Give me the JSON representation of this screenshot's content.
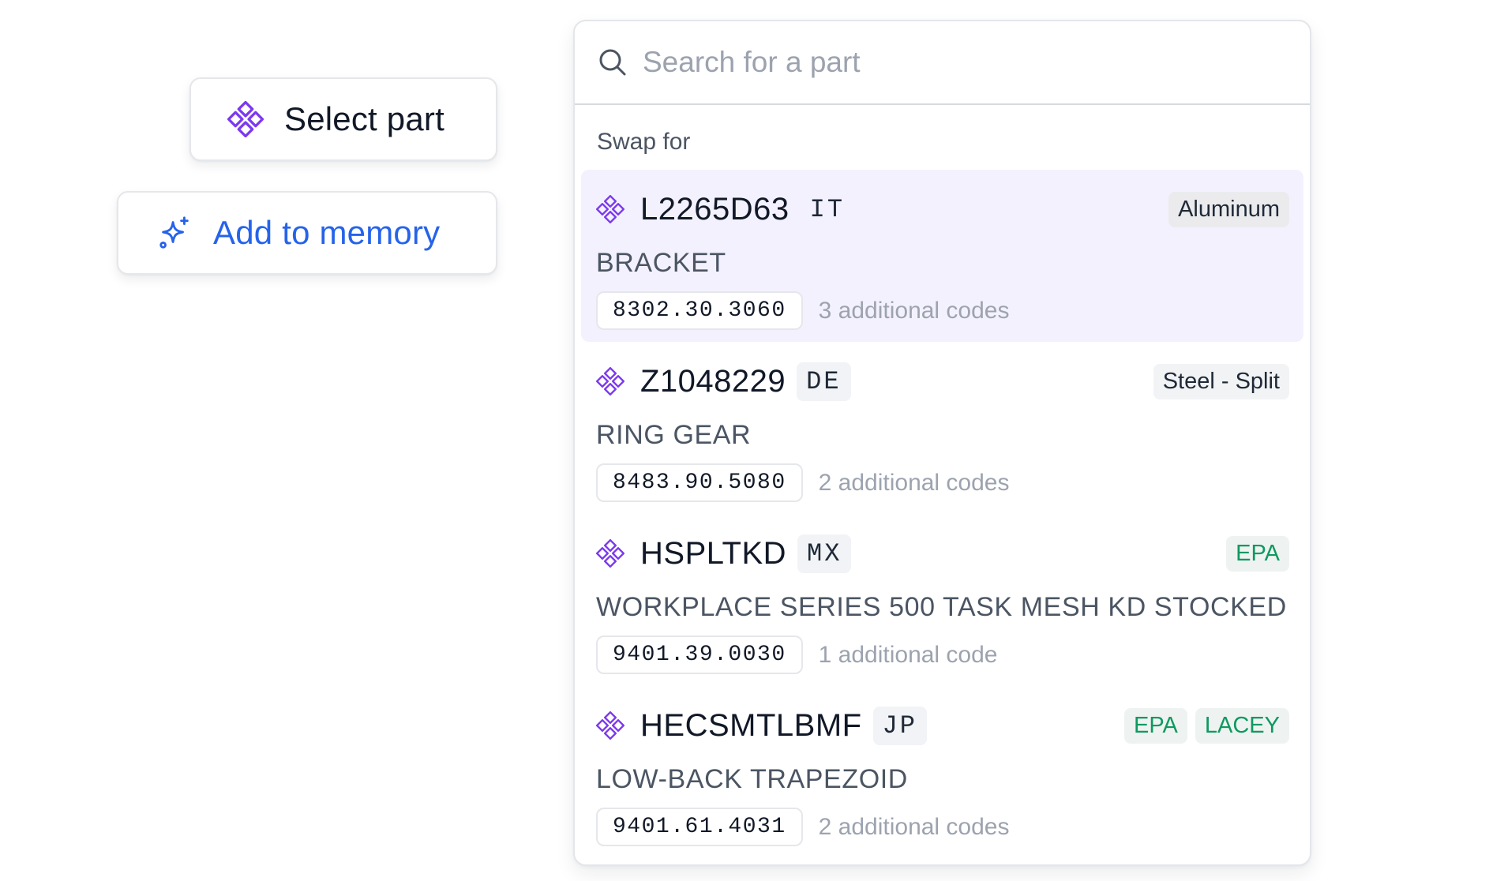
{
  "actions": {
    "select_part": {
      "label": "Select part",
      "icon": "part-diamond-icon",
      "color": "#111827",
      "icon_color": "#7c3aed"
    },
    "add_to_memory": {
      "label": "Add to memory",
      "icon": "sparkle-icon",
      "color": "#2563eb"
    }
  },
  "search": {
    "placeholder": "Search for a part",
    "value": ""
  },
  "section_label": "Swap for",
  "parts": [
    {
      "code": "L2265D63",
      "country": "IT",
      "tags": [
        {
          "label": "Aluminum",
          "style": "neutral"
        }
      ],
      "description": "BRACKET",
      "hts_code": "8302.30.3060",
      "additional": "3 additional codes",
      "highlighted": true
    },
    {
      "code": "Z1048229",
      "country": "DE",
      "tags": [
        {
          "label": "Steel - Split",
          "style": "neutral"
        }
      ],
      "description": "RING GEAR",
      "hts_code": "8483.90.5080",
      "additional": "2 additional codes",
      "highlighted": false
    },
    {
      "code": "HSPLTKD",
      "country": "MX",
      "tags": [
        {
          "label": "EPA",
          "style": "green"
        }
      ],
      "description": "WORKPLACE SERIES 500 TASK MESH KD STOCKED",
      "hts_code": "9401.39.0030",
      "additional": "1 additional code",
      "highlighted": false
    },
    {
      "code": "HECSMTLBMF",
      "country": "JP",
      "tags": [
        {
          "label": "EPA",
          "style": "green"
        },
        {
          "label": "LACEY",
          "style": "green"
        }
      ],
      "description": "LOW-BACK TRAPEZOID",
      "hts_code": "9401.61.4031",
      "additional": "2 additional codes",
      "highlighted": false
    }
  ],
  "colors": {
    "accent_purple": "#7c3aed",
    "accent_blue": "#2563eb",
    "tag_green": "#0f9960",
    "highlight_bg": "#f3f1fd"
  }
}
